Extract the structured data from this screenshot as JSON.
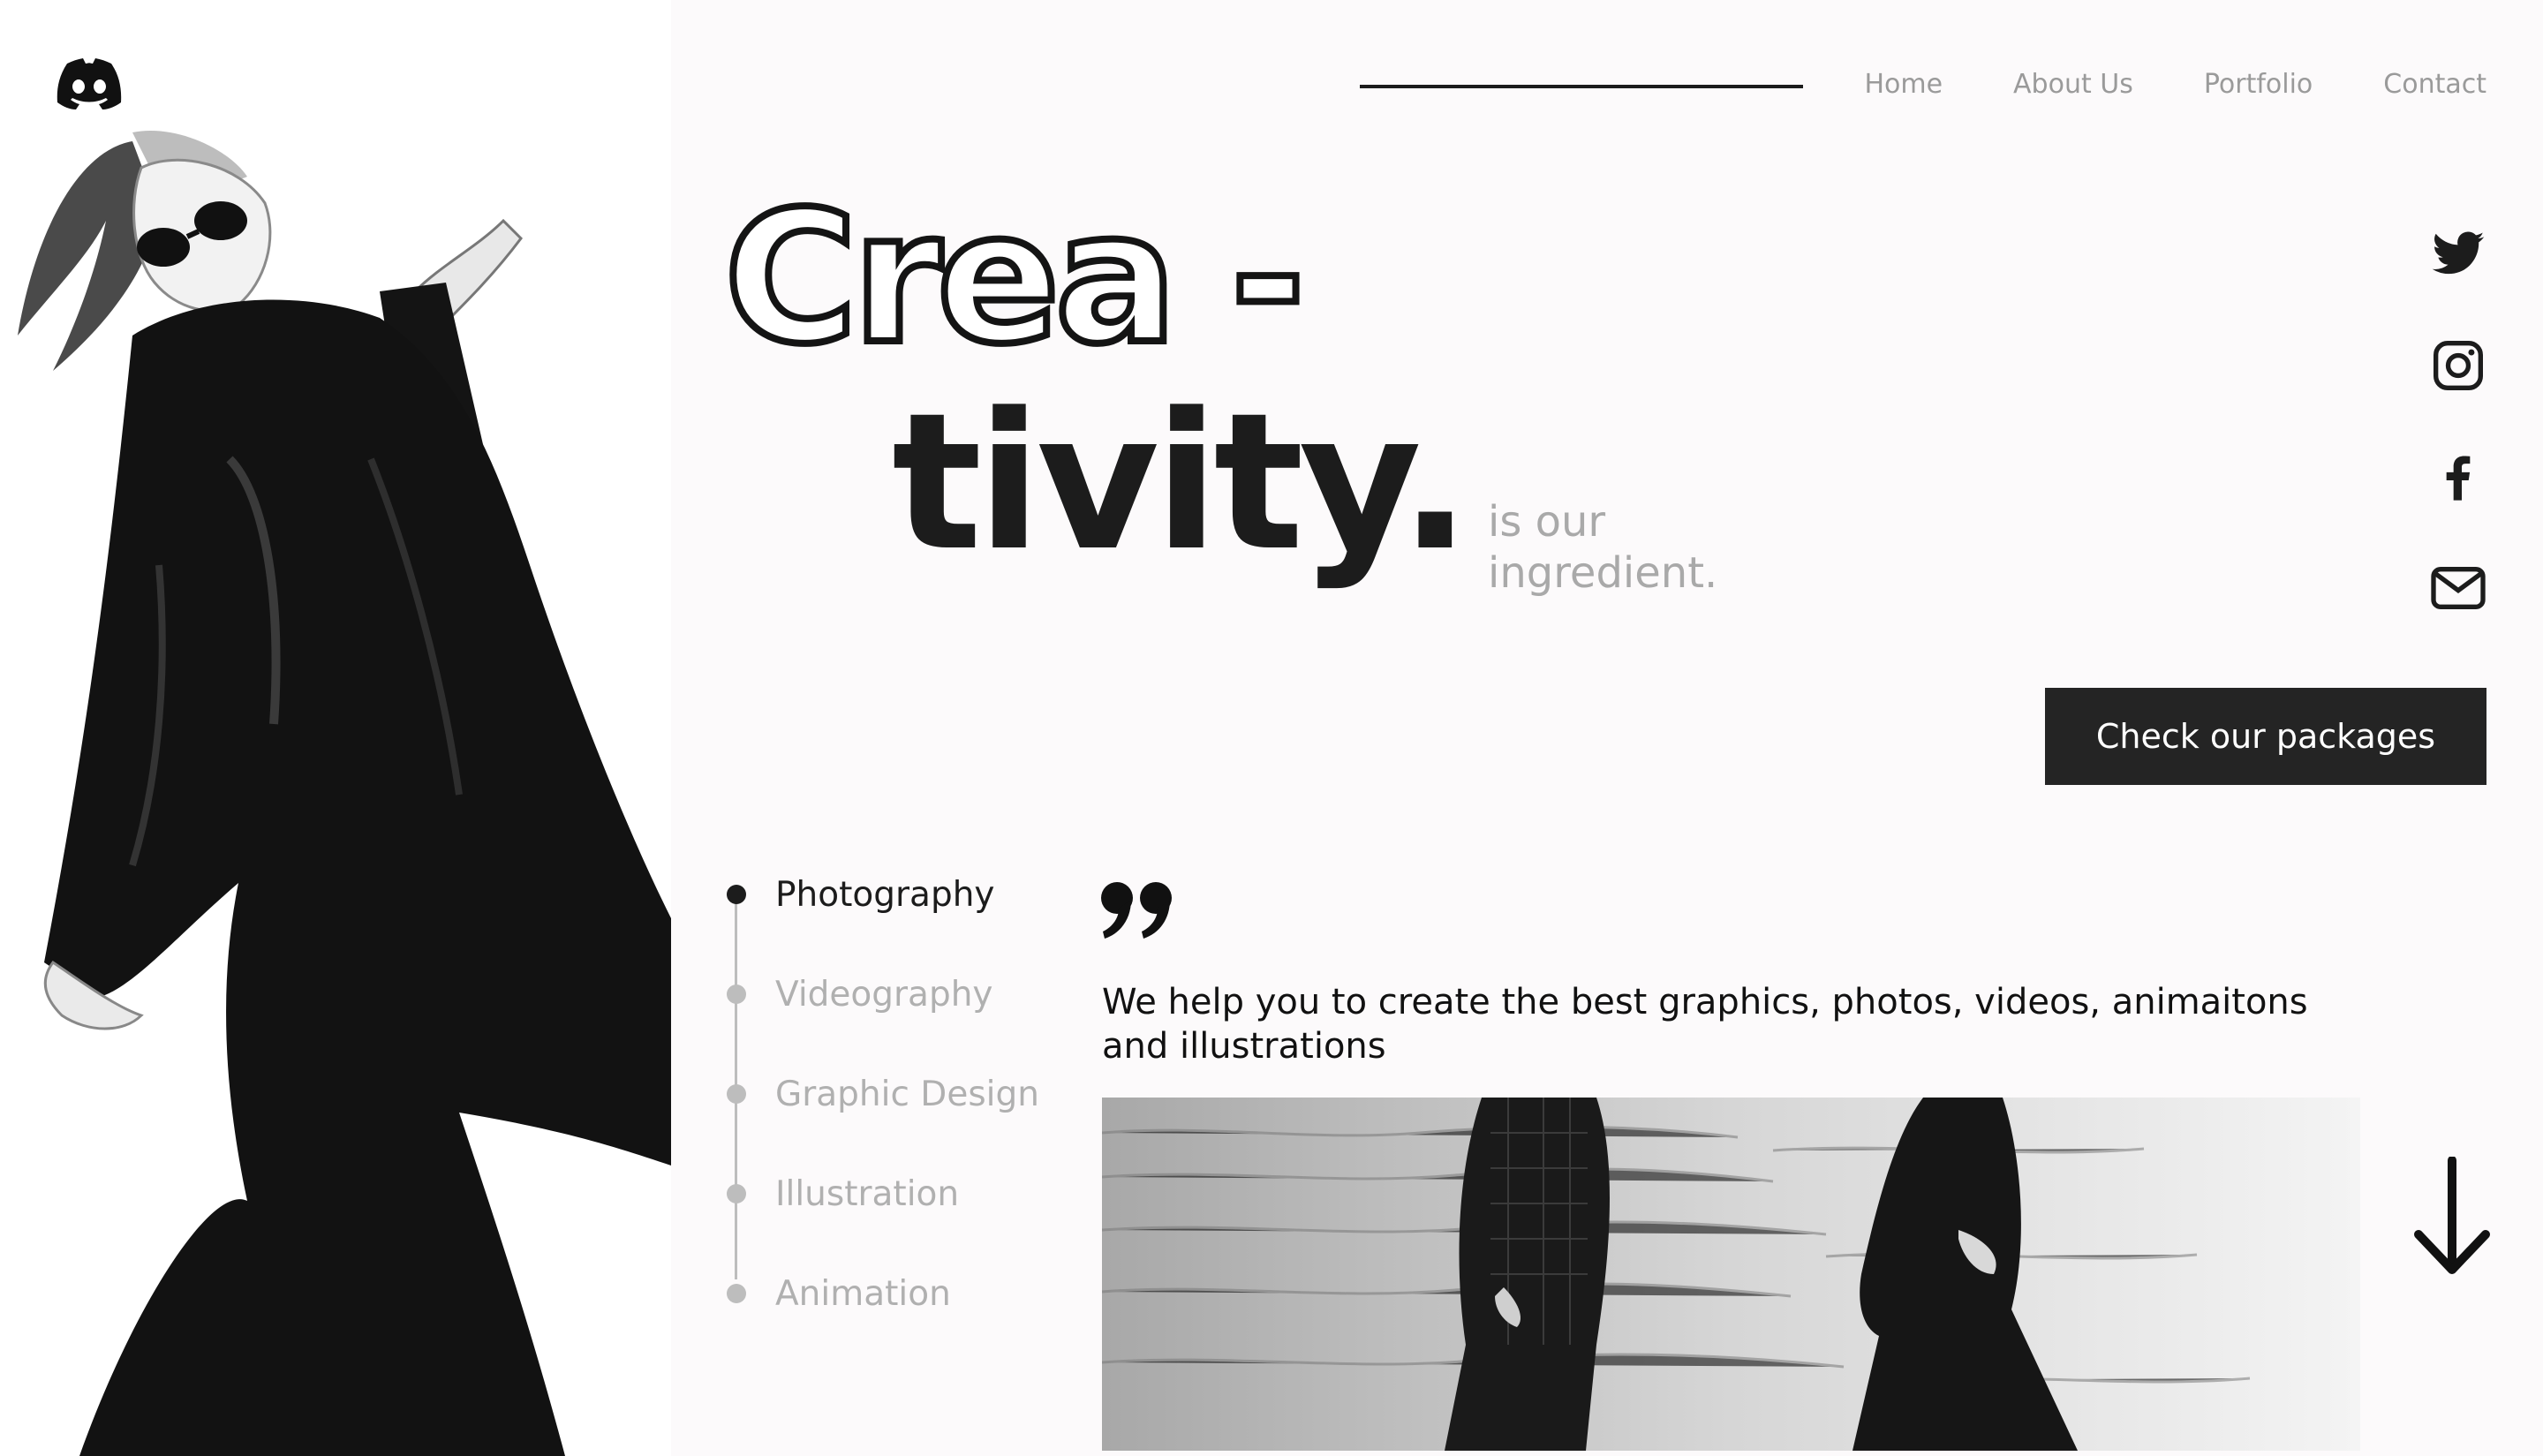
{
  "brand": {
    "logo_icon": "discord-icon"
  },
  "nav": {
    "items": [
      "Home",
      "About Us",
      "Portfolio",
      "Contact"
    ]
  },
  "hero": {
    "line1": "Crea -",
    "line2": "tivity.",
    "subtitle": "is our ingredient."
  },
  "social": {
    "icons": [
      "twitter-icon",
      "instagram-icon",
      "facebook-icon",
      "mail-icon"
    ]
  },
  "cta": {
    "label": "Check our packages"
  },
  "services": {
    "items": [
      {
        "label": "Photography",
        "active": true
      },
      {
        "label": "Videography",
        "active": false
      },
      {
        "label": "Graphic Design",
        "active": false
      },
      {
        "label": "Illustration",
        "active": false
      },
      {
        "label": "Animation",
        "active": false
      }
    ]
  },
  "quote": {
    "text": "We help you to create the best graphics, photos, videos, animaitons and illustrations"
  },
  "colors": {
    "background": "#fcfafb",
    "ink": "#1c1c1c",
    "muted": "#a9a9a9",
    "button": "#242424"
  }
}
